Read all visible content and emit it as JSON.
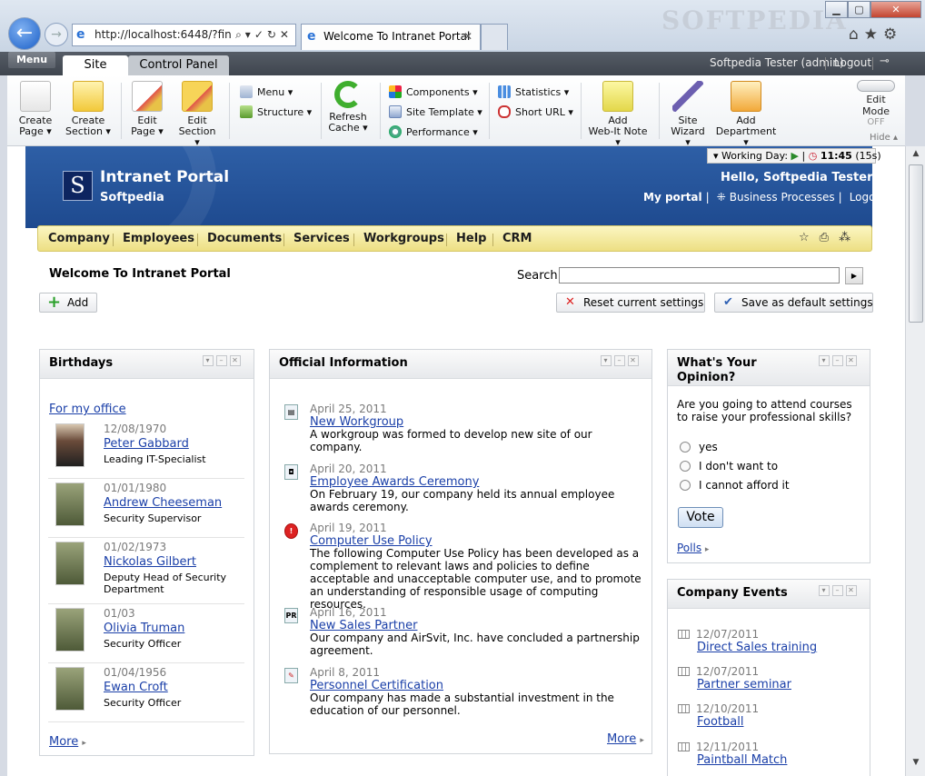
{
  "browser": {
    "address": "http://localhost:6448/?fin",
    "tab_title": "Welcome To Intranet Portal",
    "watermark": "SOFTPEDIA"
  },
  "admin_bar": {
    "menu": "Menu",
    "tabs": [
      "Site",
      "Control Panel"
    ],
    "user": "Softpedia Tester (admin)",
    "logout": "Logout"
  },
  "toolbar": {
    "create_page": [
      "Create",
      "Page"
    ],
    "create_section": [
      "Create",
      "Section"
    ],
    "edit_page": [
      "Edit",
      "Page"
    ],
    "edit_section": [
      "Edit",
      "Section"
    ],
    "menu": "Menu",
    "structure": "Structure",
    "refresh_cache": [
      "Refresh",
      "Cache"
    ],
    "components": "Components",
    "site_template": "Site Template",
    "performance": "Performance",
    "statistics": "Statistics",
    "short_url": "Short URL",
    "add_webit": [
      "Add",
      "Web-It Note"
    ],
    "site_wizard": [
      "Site",
      "Wizard"
    ],
    "add_department": [
      "Add",
      "Department"
    ],
    "edit_mode": "Edit Mode",
    "edit_mode_state": "OFF",
    "hide": "Hide"
  },
  "header": {
    "working_day": "Working Day:",
    "time": "11:45",
    "elapsed": "(15s)",
    "logo_letter": "S",
    "portal_title": "Intranet Portal",
    "company": "Softpedia",
    "hello": "Hello, Softpedia Tester",
    "links": [
      "My portal",
      "Business Processes",
      "Logout"
    ]
  },
  "nav": [
    "Company",
    "Employees",
    "Documents",
    "Services",
    "Workgroups",
    "Help",
    "CRM"
  ],
  "page": {
    "title": "Welcome To Intranet Portal",
    "search_label": "Search",
    "add": "Add",
    "reset": "Reset current settings",
    "save": "Save as default settings"
  },
  "birthdays": {
    "title": "Birthdays",
    "filter": "For my office",
    "people": [
      {
        "date": "12/08/1970",
        "name": "Peter Gabbard",
        "role": "Leading IT-Specialist"
      },
      {
        "date": "01/01/1980",
        "name": "Andrew Cheeseman",
        "role": "Security Supervisor"
      },
      {
        "date": "01/02/1973",
        "name": "Nickolas Gilbert",
        "role": "Deputy Head of Security Department"
      },
      {
        "date": "01/03",
        "name": "Olivia Truman",
        "role": "Security Officer"
      },
      {
        "date": "01/04/1956",
        "name": "Ewan Croft",
        "role": "Security Officer"
      }
    ],
    "more": "More"
  },
  "official": {
    "title": "Official Information",
    "items": [
      {
        "date": "April 25, 2011",
        "title": "New Workgroup",
        "body": "A workgroup was formed to develop new site of our company."
      },
      {
        "date": "April 20, 2011",
        "title": "Employee Awards Ceremony",
        "body": "On February 19, our company held its annual employee awards ceremony."
      },
      {
        "date": "April 19, 2011",
        "title": "Computer Use Policy",
        "body": "The following Computer Use Policy has been developed as a complement to relevant laws and policies to define acceptable and unacceptable computer use, and to promote an understanding of responsible usage of computing resources."
      },
      {
        "date": "April 16, 2011",
        "title": "New Sales Partner",
        "body": "Our company and AirSvit, Inc. have concluded a partnership agreement."
      },
      {
        "date": "April 8, 2011",
        "title": "Personnel Certification",
        "body": "Our company has made a substantial investment in the education of our personnel."
      }
    ],
    "more": "More"
  },
  "opinion": {
    "title": "What's Your Opinion?",
    "question": "Are you going to attend courses to raise your professional skills?",
    "options": [
      "yes",
      "I don't want to",
      "I cannot afford it"
    ],
    "vote": "Vote",
    "polls": "Polls"
  },
  "events": {
    "title": "Company Events",
    "items": [
      {
        "date": "12/07/2011",
        "title": "Direct Sales training"
      },
      {
        "date": "12/07/2011",
        "title": "Partner seminar"
      },
      {
        "date": "12/10/2011",
        "title": "Football"
      },
      {
        "date": "12/11/2011",
        "title": "Paintball Match"
      }
    ]
  }
}
